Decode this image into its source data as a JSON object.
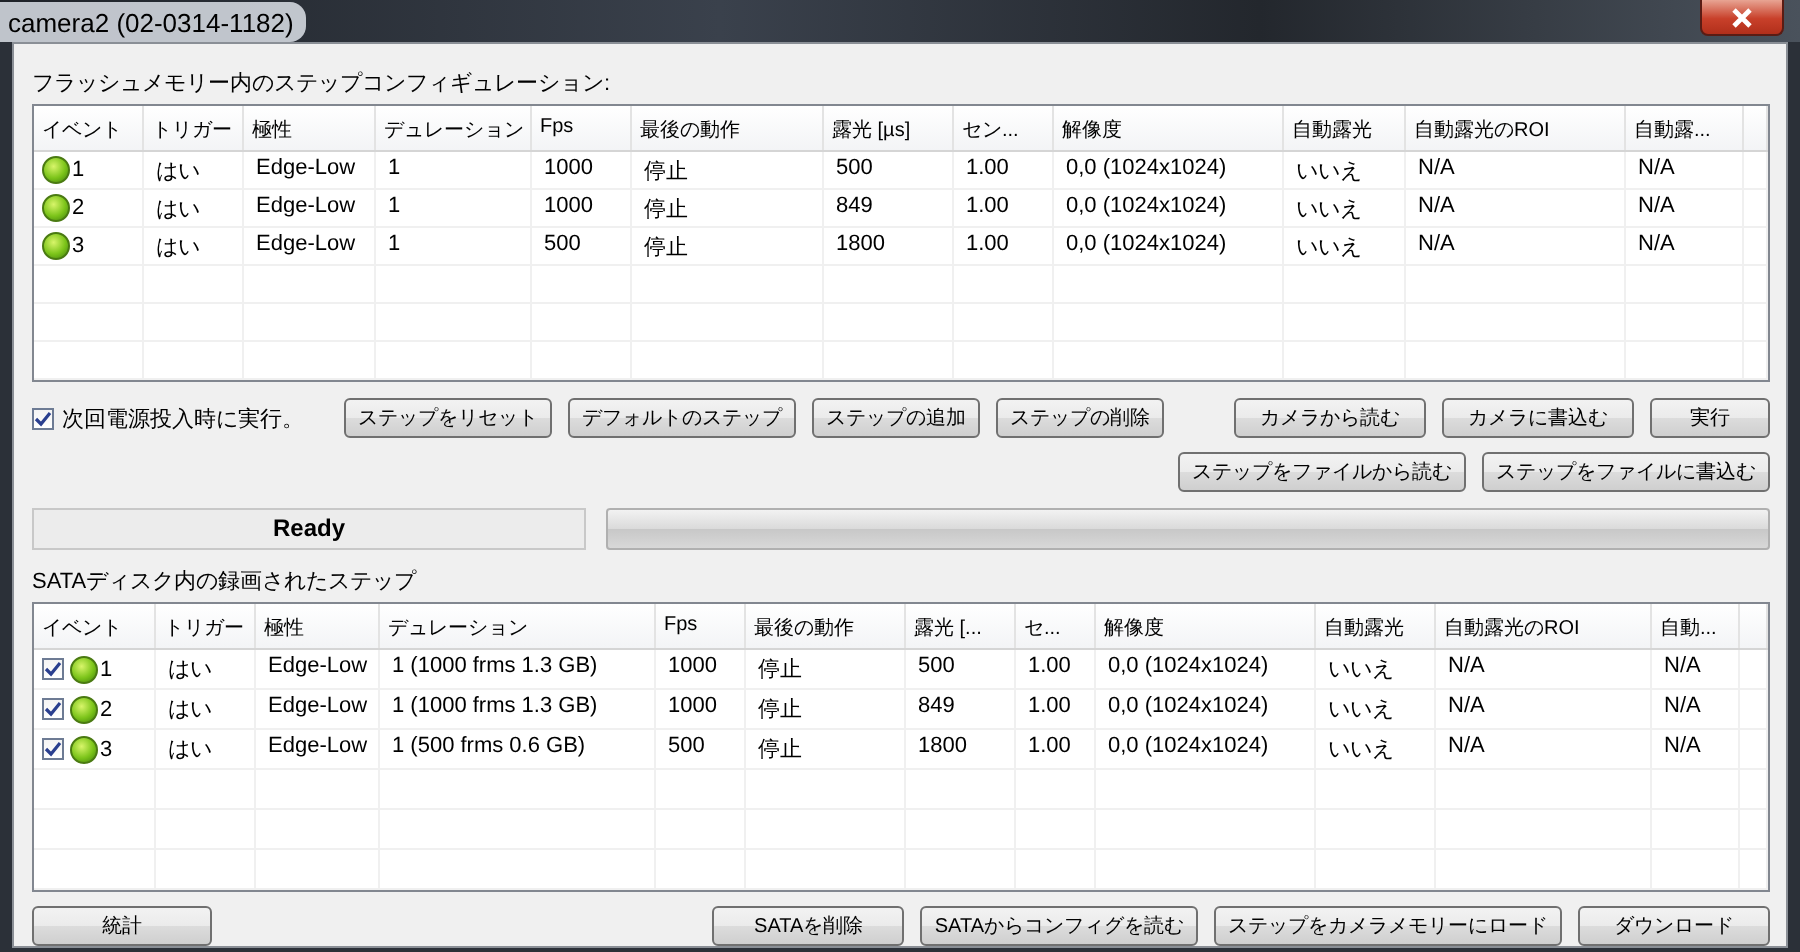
{
  "window": {
    "title": "camera2 (02-0314-1182)"
  },
  "flash_section": {
    "label": "フラッシュメモリー内のステップコンフィギュレーション:",
    "table": {
      "columns": [
        "イベント",
        "トリガー",
        "極性",
        "デュレーション",
        "Fps",
        "最後の動作",
        "露光 [µs]",
        "セン...",
        "解像度",
        "自動露光",
        "自動露光のROI",
        "自動露..."
      ],
      "rows": [
        {
          "cells": [
            "1",
            "はい",
            "Edge-Low",
            "1",
            "1000",
            "停止",
            "500",
            "1.00",
            "0,0 (1024x1024)",
            "いいえ",
            "N/A",
            "N/A"
          ]
        },
        {
          "cells": [
            "2",
            "はい",
            "Edge-Low",
            "1",
            "1000",
            "停止",
            "849",
            "1.00",
            "0,0 (1024x1024)",
            "いいえ",
            "N/A",
            "N/A"
          ]
        },
        {
          "cells": [
            "3",
            "はい",
            "Edge-Low",
            "1",
            "500",
            "停止",
            "1800",
            "1.00",
            "0,0 (1024x1024)",
            "いいえ",
            "N/A",
            "N/A"
          ]
        }
      ]
    }
  },
  "run_on_power_on": {
    "label": "次回電源投入時に実行。",
    "checked": true
  },
  "step_buttons": [
    "ステップをリセット",
    "デフォルトのステップ",
    "ステップの追加",
    "ステップの削除"
  ],
  "camera_buttons": [
    "カメラから読む",
    "カメラに書込む",
    "実行"
  ],
  "file_buttons": [
    "ステップをファイルから読む",
    "ステップをファイルに書込む"
  ],
  "status": "Ready",
  "progress": {
    "level": 0
  },
  "sata_section": {
    "label": "SATAディスク内の録画されたステップ",
    "table": {
      "columns": [
        "イベント",
        "トリガー",
        "極性",
        "デュレーション",
        "Fps",
        "最後の動作",
        "露光 [...",
        "セ...",
        "解像度",
        "自動露光",
        "自動露光のROI",
        "自動..."
      ],
      "rows": [
        {
          "checked": true,
          "cells": [
            "1",
            "はい",
            "Edge-Low",
            "1 (1000 frms 1.3 GB)",
            "1000",
            "停止",
            "500",
            "1.00",
            "0,0 (1024x1024)",
            "いいえ",
            "N/A",
            "N/A"
          ]
        },
        {
          "checked": true,
          "cells": [
            "2",
            "はい",
            "Edge-Low",
            "1 (1000 frms 1.3 GB)",
            "1000",
            "停止",
            "849",
            "1.00",
            "0,0 (1024x1024)",
            "いいえ",
            "N/A",
            "N/A"
          ]
        },
        {
          "checked": true,
          "cells": [
            "3",
            "はい",
            "Edge-Low",
            "1 (500 frms 0.6 GB)",
            "500",
            "停止",
            "1800",
            "1.00",
            "0,0 (1024x1024)",
            "いいえ",
            "N/A",
            "N/A"
          ]
        }
      ]
    }
  },
  "stats_button": "統計",
  "sata_buttons": [
    "SATAを削除",
    "SATAからコンフィグを読む",
    "ステップをカメラメモリーにロード",
    "ダウンロード"
  ]
}
